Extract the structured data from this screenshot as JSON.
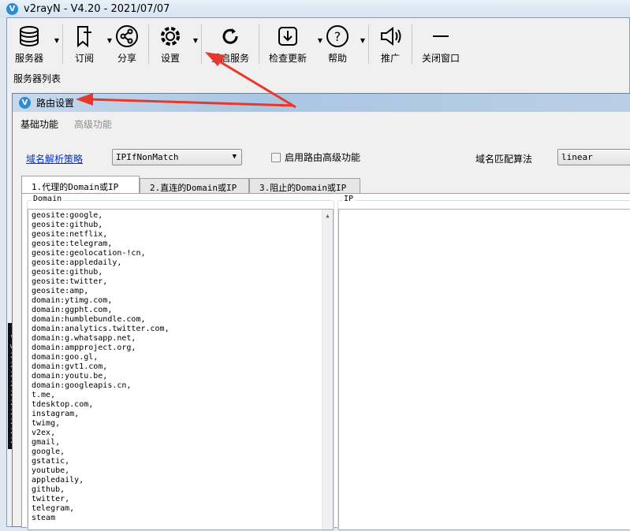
{
  "window": {
    "title": "v2rayN - V4.20 - 2021/07/07"
  },
  "toolbar": [
    {
      "label": "服务器",
      "icon": "database-icon",
      "dropdown": true
    },
    {
      "label": "订阅",
      "icon": "bookmark-plus-icon",
      "dropdown": true
    },
    {
      "label": "分享",
      "icon": "share-icon",
      "dropdown": false
    },
    {
      "label": "设置",
      "icon": "gear-icon",
      "dropdown": true
    },
    {
      "label": "重启服务",
      "icon": "reload-icon",
      "dropdown": false
    },
    {
      "label": "检查更新",
      "icon": "download-icon",
      "dropdown": true
    },
    {
      "label": "帮助",
      "icon": "help-icon",
      "dropdown": true
    },
    {
      "label": "推广",
      "icon": "megaphone-icon",
      "dropdown": false
    },
    {
      "label": "关闭窗口",
      "icon": "minimize-icon",
      "dropdown": false
    }
  ],
  "server_list_label": "服务器列表",
  "dialog": {
    "title": "路由设置",
    "menu": [
      "基础功能",
      "高级功能"
    ],
    "domain_strategy_label": "域名解析策略",
    "domain_strategy_value": "IPIfNonMatch",
    "enable_advanced_label": "启用路由高级功能",
    "enable_advanced_checked": false,
    "domain_matcher_label": "域名匹配算法",
    "domain_matcher_value": "linear",
    "tabs": [
      "1.代理的Domain或IP",
      "2.直连的Domain或IP",
      "3.阻止的Domain或IP"
    ],
    "active_tab": 0,
    "domain_group_label": "Domain",
    "ip_group_label": "IP",
    "domain_text": "geosite:google,\ngeosite:github,\ngeosite:netflix,\ngeosite:telegram,\ngeosite:geolocation-!cn,\ngeosite:appledaily,\ngeosite:github,\ngeosite:twitter,\ngeosite:amp,\ndomain:ytimg.com,\ndomain:ggpht.com,\ndomain:humblebundle.com,\ndomain:analytics.twitter.com,\ndomain:g.whatsapp.net,\ndomain:ampproject.org,\ndomain:goo.gl,\ndomain:gvt1.com,\ndomain:youtu.be,\ndomain:googleapis.cn,\nt.me,\ntdesktop.com,\ninstagram,\ntwimg,\nv2ex,\ngmail,\ngoogle,\ngstatic,\nyoutube,\nappledaily,\ngithub,\ntwitter,\ntelegram,\nsteam",
    "ip_text": ""
  },
  "colors": {
    "arrow": "#e8372c",
    "link": "#0033cc"
  }
}
